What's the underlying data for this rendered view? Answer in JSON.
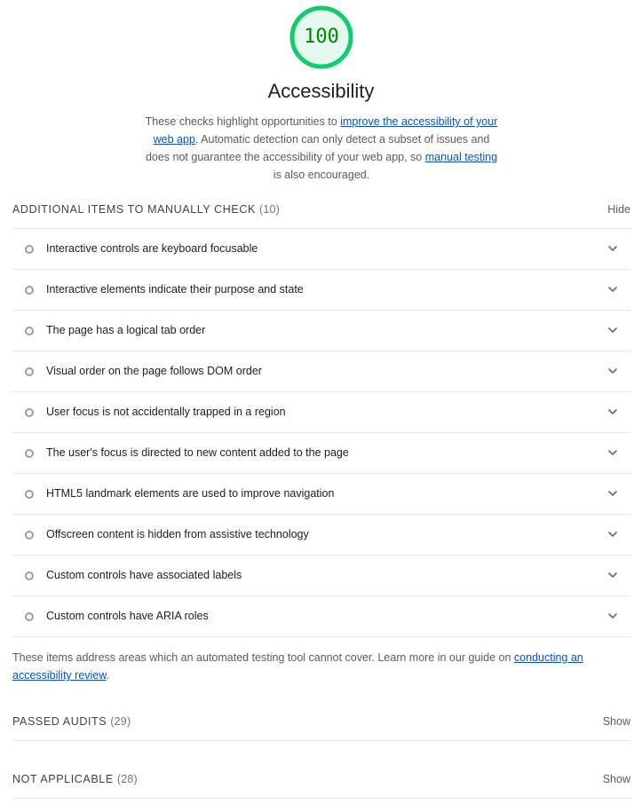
{
  "category": {
    "score": "100",
    "score_color": "#0cce6b",
    "title": "Accessibility",
    "description": {
      "pre": "These checks highlight opportunities to ",
      "link1": "improve the accessibility of your web app",
      "mid": ". Automatic detection can only detect a subset of issues and does not guarantee the accessibility of your web app, so ",
      "link2": "manual testing",
      "post": " is also encouraged."
    }
  },
  "manual_group": {
    "title": "Additional items to manually check",
    "count": "(10)",
    "toggle_label": "Hide",
    "items": [
      {
        "label": "Interactive controls are keyboard focusable"
      },
      {
        "label": "Interactive elements indicate their purpose and state"
      },
      {
        "label": "The page has a logical tab order"
      },
      {
        "label": "Visual order on the page follows DOM order"
      },
      {
        "label": "User focus is not accidentally trapped in a region"
      },
      {
        "label": "The user's focus is directed to new content added to the page"
      },
      {
        "label": "HTML5 landmark elements are used to improve navigation"
      },
      {
        "label": "Offscreen content is hidden from assistive technology"
      },
      {
        "label": "Custom controls have associated labels"
      },
      {
        "label": "Custom controls have ARIA roles"
      }
    ],
    "footer": {
      "pre": "These items address areas which an automated testing tool cannot cover. Learn more in our guide on ",
      "link": "conducting an accessibility review",
      "post": "."
    }
  },
  "passed_group": {
    "title": "Passed audits",
    "count": "(29)",
    "toggle_label": "Show"
  },
  "na_group": {
    "title": "Not applicable",
    "count": "(28)",
    "toggle_label": "Show"
  },
  "icons": {
    "audit_status": "informative-circle-icon",
    "expand": "chevron-down-icon"
  }
}
